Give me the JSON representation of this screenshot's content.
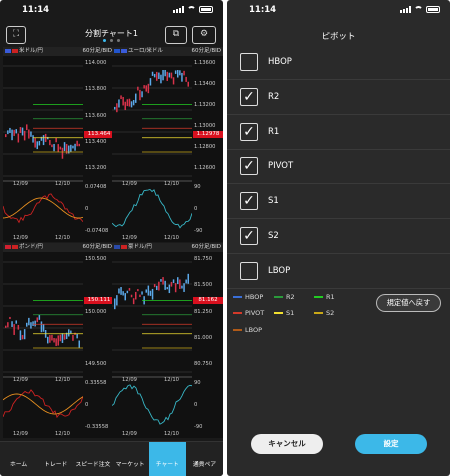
{
  "status": {
    "time": "11:14"
  },
  "left": {
    "title": "分割チャート1",
    "panels": [
      {
        "pair": "米ドル/円",
        "tf": "60分足/BID",
        "axis": [
          "114.000",
          "113.800",
          "113.600",
          "113.400",
          "113.200"
        ],
        "price": "113.464",
        "sub_axis": [
          "0.07408",
          "0",
          "-0.07408"
        ],
        "dates": [
          "12/09",
          "12/10"
        ],
        "f1": "#3a5bd9",
        "f2": "#cc2222"
      },
      {
        "pair": "ユーロ/米ドル",
        "tf": "60分足/BID",
        "axis": [
          "1.13600",
          "1.13400",
          "1.13200",
          "1.13000",
          "1.12800",
          "1.12600"
        ],
        "price": "1.12978",
        "sub_axis": [
          "90",
          "0",
          "-90"
        ],
        "dates": [
          "12/09",
          "12/10"
        ],
        "f1": "#2255cc",
        "f2": "#3a5bd9"
      },
      {
        "pair": "ポンド/円",
        "tf": "60分足/BID",
        "axis": [
          "150.500",
          "150.000",
          "149.500"
        ],
        "price": "150.111",
        "sub_axis": [
          "0.33558",
          "0",
          "-0.33558"
        ],
        "dates": [
          "12/09",
          "12/10"
        ],
        "f1": "#d02030",
        "f2": "#cc2222"
      },
      {
        "pair": "豪ドル/円",
        "tf": "60分足/BID",
        "axis": [
          "81.750",
          "81.500",
          "81.250",
          "81.000",
          "80.750"
        ],
        "price": "81.162",
        "sub_axis": [
          "90",
          "0",
          "-90"
        ],
        "dates": [
          "12/09",
          "12/10"
        ],
        "f1": "#2a4aa8",
        "f2": "#cc2222"
      }
    ],
    "nav": [
      {
        "label": "ホーム",
        "icon": "⌂"
      },
      {
        "label": "トレード",
        "icon": "⇆"
      },
      {
        "label": "スピード注文",
        "icon": "⇋"
      },
      {
        "label": "マーケット",
        "icon": "◍"
      },
      {
        "label": "チャート",
        "icon": "▟"
      },
      {
        "label": "通貨ペア",
        "icon": "⚙"
      }
    ]
  },
  "right": {
    "title": "ピボット",
    "items": [
      {
        "label": "HBOP",
        "checked": false
      },
      {
        "label": "R2",
        "checked": true
      },
      {
        "label": "R1",
        "checked": true
      },
      {
        "label": "PIVOT",
        "checked": true
      },
      {
        "label": "S1",
        "checked": true
      },
      {
        "label": "S2",
        "checked": true
      },
      {
        "label": "LBOP",
        "checked": false
      }
    ],
    "legend": [
      {
        "label": "HBOP",
        "color": "#3a6fd8"
      },
      {
        "label": "R2",
        "color": "#2a9a3a"
      },
      {
        "label": "R1",
        "color": "#22cc22"
      },
      {
        "label": "PIVOT",
        "color": "#d43a2a"
      },
      {
        "label": "S1",
        "color": "#f2e030"
      },
      {
        "label": "S2",
        "color": "#c9a818"
      },
      {
        "label": "LBOP",
        "color": "#b05a18"
      }
    ],
    "reset_label": "規定値へ戻す",
    "cancel_label": "キャンセル",
    "ok_label": "設定"
  }
}
